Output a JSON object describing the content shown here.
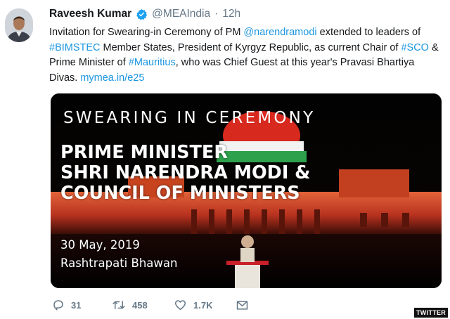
{
  "tweet": {
    "author_name": "Raveesh Kumar",
    "handle": "@MEAIndia",
    "separator": "·",
    "time": "12h",
    "text_segments": [
      {
        "text": "Invitation for Swearing-in Ceremony of PM ",
        "type": "text"
      },
      {
        "text": "@narendramodi",
        "type": "link"
      },
      {
        "text": " extended to leaders of ",
        "type": "text"
      },
      {
        "text": "#BIMSTEC",
        "type": "link"
      },
      {
        "text": " Member States, President of Kyrgyz Republic, as current Chair of ",
        "type": "text"
      },
      {
        "text": "#SCO",
        "type": "link"
      },
      {
        "text": " & Prime Minister of ",
        "type": "text"
      },
      {
        "text": "#Mauritius",
        "type": "link"
      },
      {
        "text": ", who was Chief Guest at this year's Pravasi Bhartiya Divas. ",
        "type": "text"
      },
      {
        "text": "mymea.in/e25",
        "type": "link"
      }
    ]
  },
  "media": {
    "title": "SWEARING IN CEREMONY",
    "headline_lines": [
      "PRIME MINISTER",
      "SHRI NARENDRA MODI &",
      "COUNCIL OF MINISTERS"
    ],
    "date": "30 May, 2019",
    "venue": "Rashtrapati Bhawan"
  },
  "actions": {
    "replies": "31",
    "retweets": "458",
    "likes": "1.7K"
  },
  "watermark": "TWITTER",
  "colors": {
    "link": "#1b95e0",
    "secondary_text": "#657786",
    "verified": "#1da1f2"
  },
  "icons": [
    "verified-badge-icon",
    "reply-icon",
    "retweet-icon",
    "like-icon",
    "message-icon"
  ]
}
